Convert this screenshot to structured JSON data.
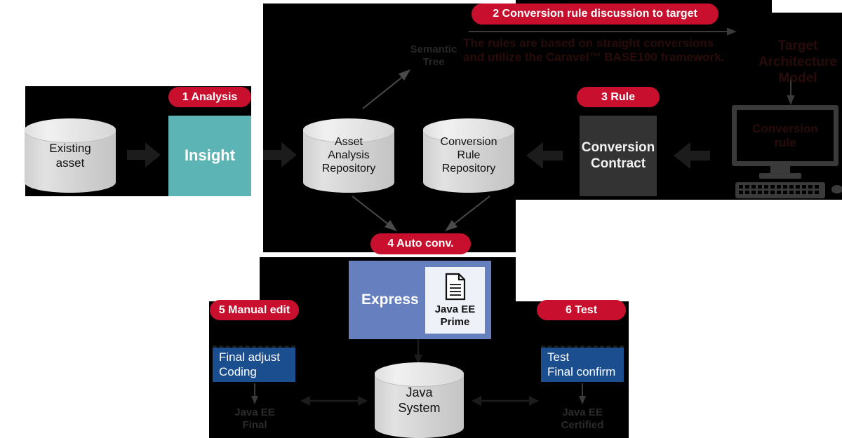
{
  "diagram": {
    "title": "Legacy asset modernization conversion flow",
    "colors": {
      "badge_red": "#c8102e",
      "insight_teal": "#5cb4b4",
      "contract_gray": "#333333",
      "express_blue": "#6680bf",
      "box_blue": "#1a4e8f",
      "panel_black": "#000000"
    }
  },
  "badges": [
    {
      "id": "analysis",
      "label": "1 Analysis"
    },
    {
      "id": "conversion",
      "label": "2 Conversion rule discussion to target"
    },
    {
      "id": "rule",
      "label": "3 Rule"
    },
    {
      "id": "auto",
      "label": "4 Auto conv."
    },
    {
      "id": "manual",
      "label": "5 Manual edit"
    },
    {
      "id": "test",
      "label": "6 Test"
    }
  ],
  "stage1": {
    "existing_asset": "Existing\nasset",
    "existing_asset_l1": "Existing",
    "existing_asset_l2": "asset",
    "insight": "Insight"
  },
  "stage2": {
    "semantic_tree_l1": "Semantic",
    "semantic_tree_l2": "Tree",
    "asset_repo_l1": "Asset",
    "asset_repo_l2": "Analysis",
    "asset_repo_l3": "Repository",
    "rule_repo_l1": "Conversion",
    "rule_repo_l2": "Rule",
    "rule_repo_l3": "Repository",
    "note_l1": "The rules are based on straight conversions",
    "note_l2": "and utilize the Caravel™ BASE100 framework.",
    "contract_l1": "Conversion",
    "contract_l2": "Contract",
    "target_model_l1": "Target",
    "target_model_l2": "Architecture",
    "target_model_l3": "Model",
    "monitor_l1": "Conversion",
    "monitor_l2": "rule"
  },
  "stage3": {
    "express": "Express",
    "prime_l1": "Java EE",
    "prime_l2": "Prime",
    "prime_icon": "document-icon",
    "java_system_l1": "Java",
    "java_system_l2": "System",
    "final_adjust_l1": "Final adjust",
    "final_adjust_l2": "Coding",
    "java_ee_final_l1": "Java EE",
    "java_ee_final_l2": "Final",
    "test_confirm_l1": "Test",
    "test_confirm_l2": "Final confirm",
    "java_ee_cert_l1": "Java EE",
    "java_ee_cert_l2": "Certified"
  }
}
